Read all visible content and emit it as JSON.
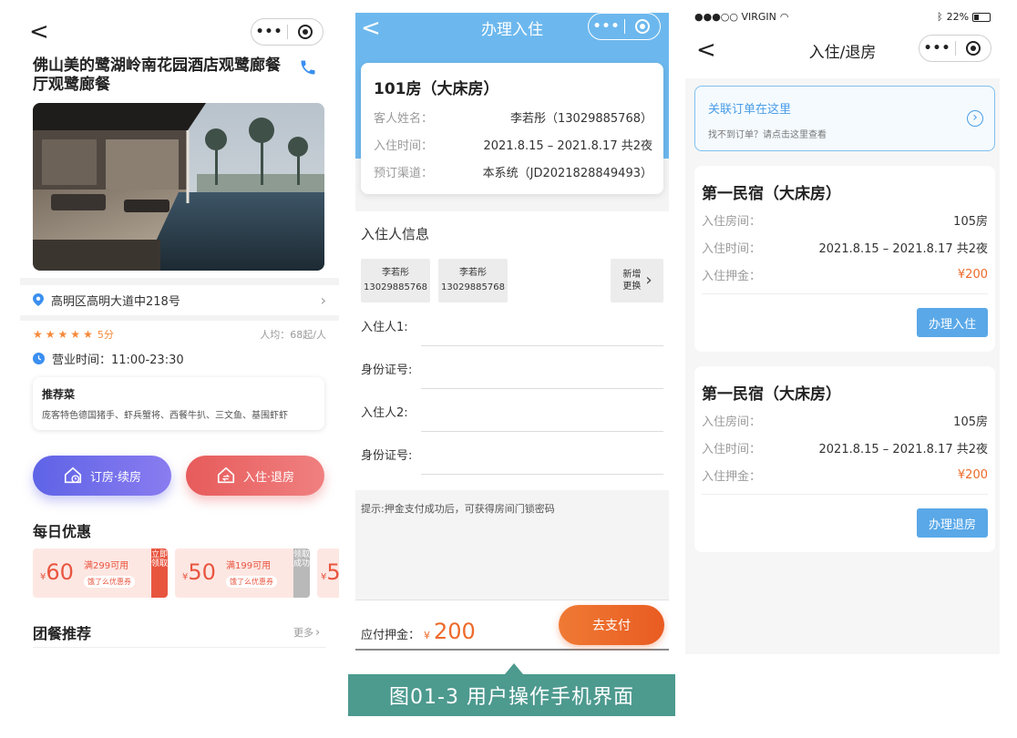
{
  "screen1": {
    "back_glyph": "<",
    "hotel_name": "佛山美的鹭湖岭南花园酒店观鹭廊餐厅观鹭廊餐",
    "address": "高明区高明大道中218号",
    "rating": "5分",
    "avg_price": "人均：68起/人",
    "hours": "营业时间：11:00-23:30",
    "recommend_title": "推荐菜",
    "recommend_items": "庞客特色德国猪手、虾兵蟹将、西餐牛扒、三文鱼、基围虾虾",
    "btn_book": "订房·续房",
    "btn_checkin": "入住·退房",
    "daily_title": "每日优惠",
    "coupons": [
      {
        "currency": "¥",
        "amount": "60",
        "condition": "满299可用",
        "source": "饿了么优惠券",
        "tab": "立即领取"
      },
      {
        "currency": "¥",
        "amount": "50",
        "condition": "满199可用",
        "source": "饿了么优惠券",
        "tab": "领取成功"
      },
      {
        "currency": "¥",
        "amount": "5"
      }
    ],
    "group_title": "团餐推荐",
    "more": "更多",
    "colors": {
      "book_btn": "#6e6fe8",
      "checkin_btn": "#ea6a6a",
      "star": "#f6893a"
    }
  },
  "screen2": {
    "title": "办理入住",
    "back_glyph": "<",
    "room_title": "101房（大床房）",
    "guest_label": "客人姓名：",
    "guest_value": "李若彤（13029885768）",
    "time_label": "入住时间：",
    "time_value": "2021.8.15 – 2021.8.17 共2夜",
    "channel_label": "预订渠道：",
    "channel_value": "本系统（JD2021828849493）",
    "occupant_title": "入住人信息",
    "guests": [
      {
        "name": "李若彤",
        "phone": "13029885768"
      },
      {
        "name": "李若彤",
        "phone": "13029885768"
      }
    ],
    "add_label": "新增更换",
    "fields": [
      "入住人1:",
      "身份证号:",
      "入住人2:",
      "身份证号:"
    ],
    "hint": "提示:押金支付成功后，可获得房间门锁密码",
    "deposit_label": "应付押金：",
    "deposit_currency": "¥",
    "deposit_amount": "200",
    "pay_btn": "去支付",
    "colors": {
      "header": "#6cb8ee",
      "pay_btn": "#ee6a2a",
      "amount": "#ee6a2a"
    }
  },
  "screen3": {
    "status": {
      "carrier": "●●●○○ VIRGIN",
      "battery": "22%"
    },
    "back_glyph": "<",
    "title": "入住/退房",
    "link_title": "关联订单在这里",
    "link_sub": "找不到订单？请点击这里查看",
    "orders": [
      {
        "title": "第一民宿（大床房）",
        "room_label": "入住房间：",
        "room": "105房",
        "time_label": "入住时间：",
        "time": "2021.8.15 – 2021.8.17 共2夜",
        "deposit_label": "入住押金：",
        "deposit": "¥200",
        "action": "办理入住"
      },
      {
        "title": "第一民宿（大床房）",
        "room_label": "入住房间：",
        "room": "105房",
        "time_label": "入住时间：",
        "time": "2021.8.15 – 2021.8.17 共2夜",
        "deposit_label": "入住押金：",
        "deposit": "¥200",
        "action": "办理退房"
      }
    ],
    "colors": {
      "link": "#4a9de8",
      "action_btn": "#5aa8e8",
      "deposit": "#ee6a2a"
    }
  },
  "caption": "图01-3  用户操作手机界面",
  "caption_color": "#4d9a8f"
}
